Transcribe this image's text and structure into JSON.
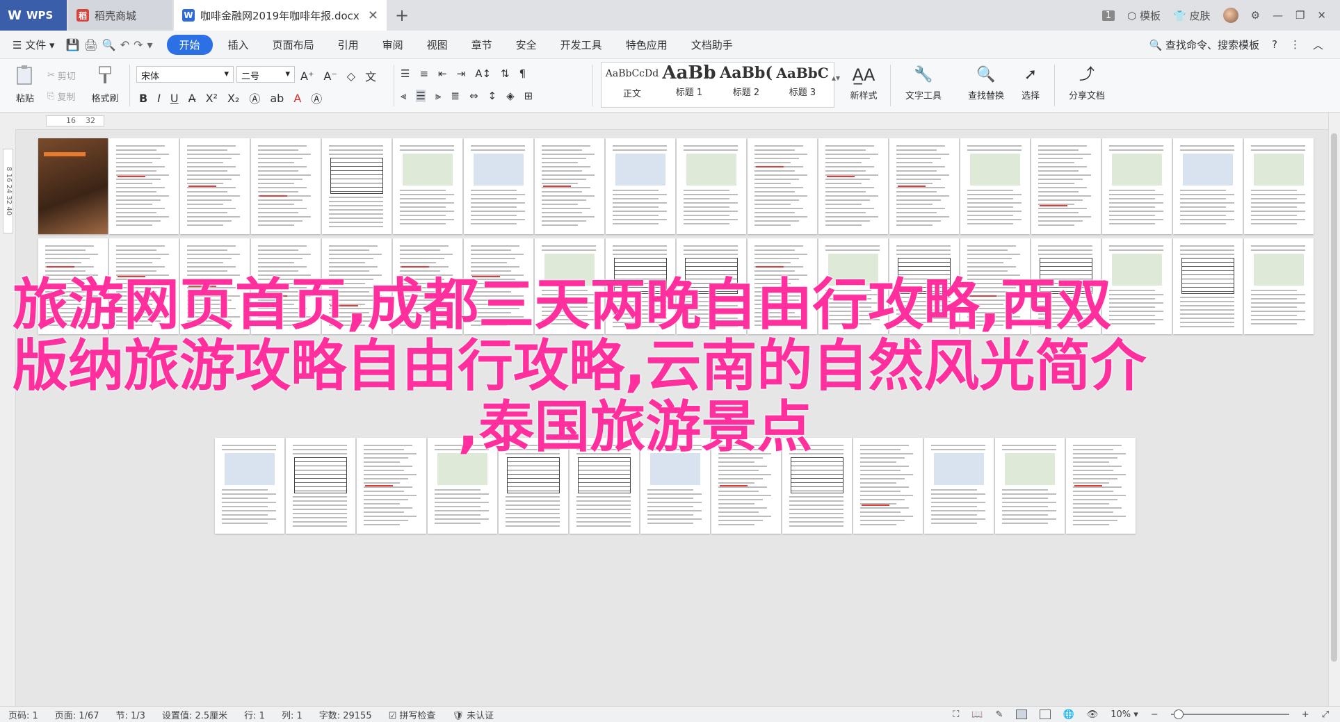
{
  "tabs": {
    "wps_label": "WPS",
    "store_label": "稻壳商城",
    "doc_title": "咖啡金融网2019年咖啡年报.docx",
    "page_count_badge": "1",
    "template_label": "模板",
    "skin_label": "皮肤"
  },
  "menu": {
    "file_label": "文件",
    "items": [
      "开始",
      "插入",
      "页面布局",
      "引用",
      "审阅",
      "视图",
      "章节",
      "安全",
      "开发工具",
      "特色应用",
      "文档助手"
    ],
    "active_index": 0,
    "search_label": "查找命令、搜索模板"
  },
  "ribbon": {
    "paste_label": "粘贴",
    "cut_label": "剪切",
    "copy_label": "复制",
    "format_painter_label": "格式刷",
    "font_name": "宋体",
    "font_size": "二号",
    "styles": [
      {
        "sample": "AaBbCcDd",
        "label": "正文"
      },
      {
        "sample": "AaBb",
        "label": "标题 1"
      },
      {
        "sample": "AaBb(",
        "label": "标题 2"
      },
      {
        "sample": "AaBbC",
        "label": "标题 3"
      }
    ],
    "new_style_label": "新样式",
    "text_tools_label": "文字工具",
    "find_replace_label": "查找替换",
    "select_label": "选择",
    "share_label": "分享文档"
  },
  "ruler": {
    "h_ticks": [
      "16",
      "32"
    ],
    "v_ticks": [
      "8",
      "16",
      "24",
      "32",
      "40"
    ]
  },
  "overlay_title": {
    "line1": "旅游网页首页,成都三天两晚自由行攻略,西双",
    "line2": "版纳旅游攻略自由行攻略,云南的自然风光简介",
    "line3": ",泰国旅游景点"
  },
  "status": {
    "page_num": "页码: 1",
    "page_of": "页面: 1/67",
    "section": "节: 1/3",
    "setting": "设置值: 2.5厘米",
    "row": "行: 1",
    "col": "列: 1",
    "word_count": "字数: 29155",
    "spell_check": "拼写检查",
    "auth": "未认证",
    "zoom": "10%"
  }
}
